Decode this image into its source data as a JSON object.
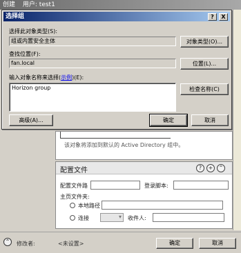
{
  "bg_window": {
    "title_prefix": "创建",
    "title_user": "用户: test1"
  },
  "bg_panel": {
    "description": "该对象将添加到默认的 Active Directory 组中。"
  },
  "profile": {
    "title": "配置文件",
    "profile_path_label": "配置文件路",
    "logon_script_label": "登录脚本:",
    "home_folder_label": "主页文件夹:",
    "local_path_label": "本地路径",
    "connect_label": "连接",
    "recipient_label": "收件人:"
  },
  "bg_bottom": {
    "modified_by_label": "修改者:",
    "modified_by_value": "<未设置>",
    "ok_label": "确定",
    "cancel_label": "取消"
  },
  "dialog": {
    "title": "选择组",
    "help_btn": "?",
    "close_btn": "X",
    "object_type_label": "选择此对象类型(S):",
    "object_type_value": "组或内置安全主体",
    "object_type_button": "对象类型(O)...",
    "location_label": "查找位置(F):",
    "location_value": "fan.local",
    "location_button": "位置(L)...",
    "names_label_pre": "输入对象名称来选择(",
    "names_label_link": "示例",
    "names_label_post": ")(E):",
    "names_value": "Horizon group",
    "check_names_button": "检查名称(C)",
    "advanced_button": "高级(A)...",
    "ok_button": "确定",
    "cancel_button": "取消"
  }
}
